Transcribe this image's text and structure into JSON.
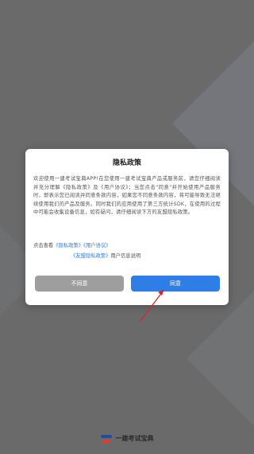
{
  "dialog": {
    "title": "隐私政策",
    "body": "欢迎使用一建考试宝典APP!在您使用一建考试宝典产品或服务前，请您仔细阅读并充分理解《隐私政策》及《用户协议》；当您点击\"同意\"并开始使用产品服务时，即表示您已阅读并同意条款内容，如果您不同意条款内容，将可能导致无法继续使用我们的产品及服务。同时我们的应用使用了第三方统计SDK，在使用的过程中可能会收集设备信息，如有疑问，请仔细阅读下方的友盟隐私政策。",
    "view_prefix": "点击查看",
    "privacy_link": "《隐私政策》",
    "user_agreement_link": "《用户协议》",
    "umeng_link": "《友盟隐私政策》",
    "umeng_suffix": "用户信息说明",
    "disagree_label": "不同意",
    "agree_label": "同意"
  },
  "footer": {
    "app_name": "一建考试宝典"
  },
  "colors": {
    "accent": "#2f7de6",
    "disagree": "#9e9e9e",
    "overlay": "#6a6a6a",
    "arrow": "#d8262e"
  }
}
